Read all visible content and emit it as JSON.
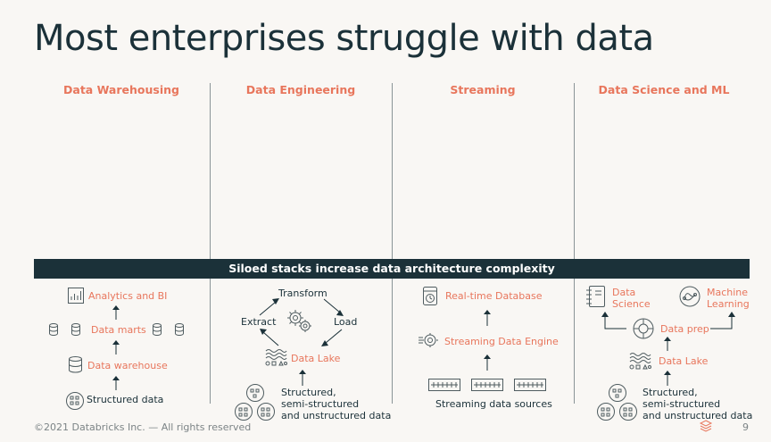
{
  "title": "Most enterprises struggle with data",
  "columns": [
    "Data Warehousing",
    "Data Engineering",
    "Streaming",
    "Data Science and ML"
  ],
  "banner": "Siloed stacks increase data architecture complexity",
  "warehousing": {
    "analytics": "Analytics and BI",
    "marts": "Data marts",
    "warehouse": "Data warehouse",
    "structured": "Structured data"
  },
  "engineering": {
    "transform": "Transform",
    "extract": "Extract",
    "load": "Load",
    "lake": "Data Lake",
    "data_line1": "Structured,",
    "data_line2": "semi-structured",
    "data_line3": "and unstructured data"
  },
  "streaming": {
    "realtime_db": "Real-time Database",
    "engine": "Streaming Data Engine",
    "sources": "Streaming data sources"
  },
  "science": {
    "ds_line1": "Data",
    "ds_line2": "Science",
    "ml_line1": "Machine",
    "ml_line2": "Learning",
    "prep": "Data prep",
    "lake": "Data Lake",
    "data_line1": "Structured,",
    "data_line2": "semi-structured",
    "data_line3": "and unstructured data"
  },
  "footer": "©2021 Databricks Inc. — All rights reserved",
  "page_number": "9",
  "colors": {
    "accent": "#e8765c",
    "dark": "#1b3139",
    "background": "#f9f7f4"
  }
}
